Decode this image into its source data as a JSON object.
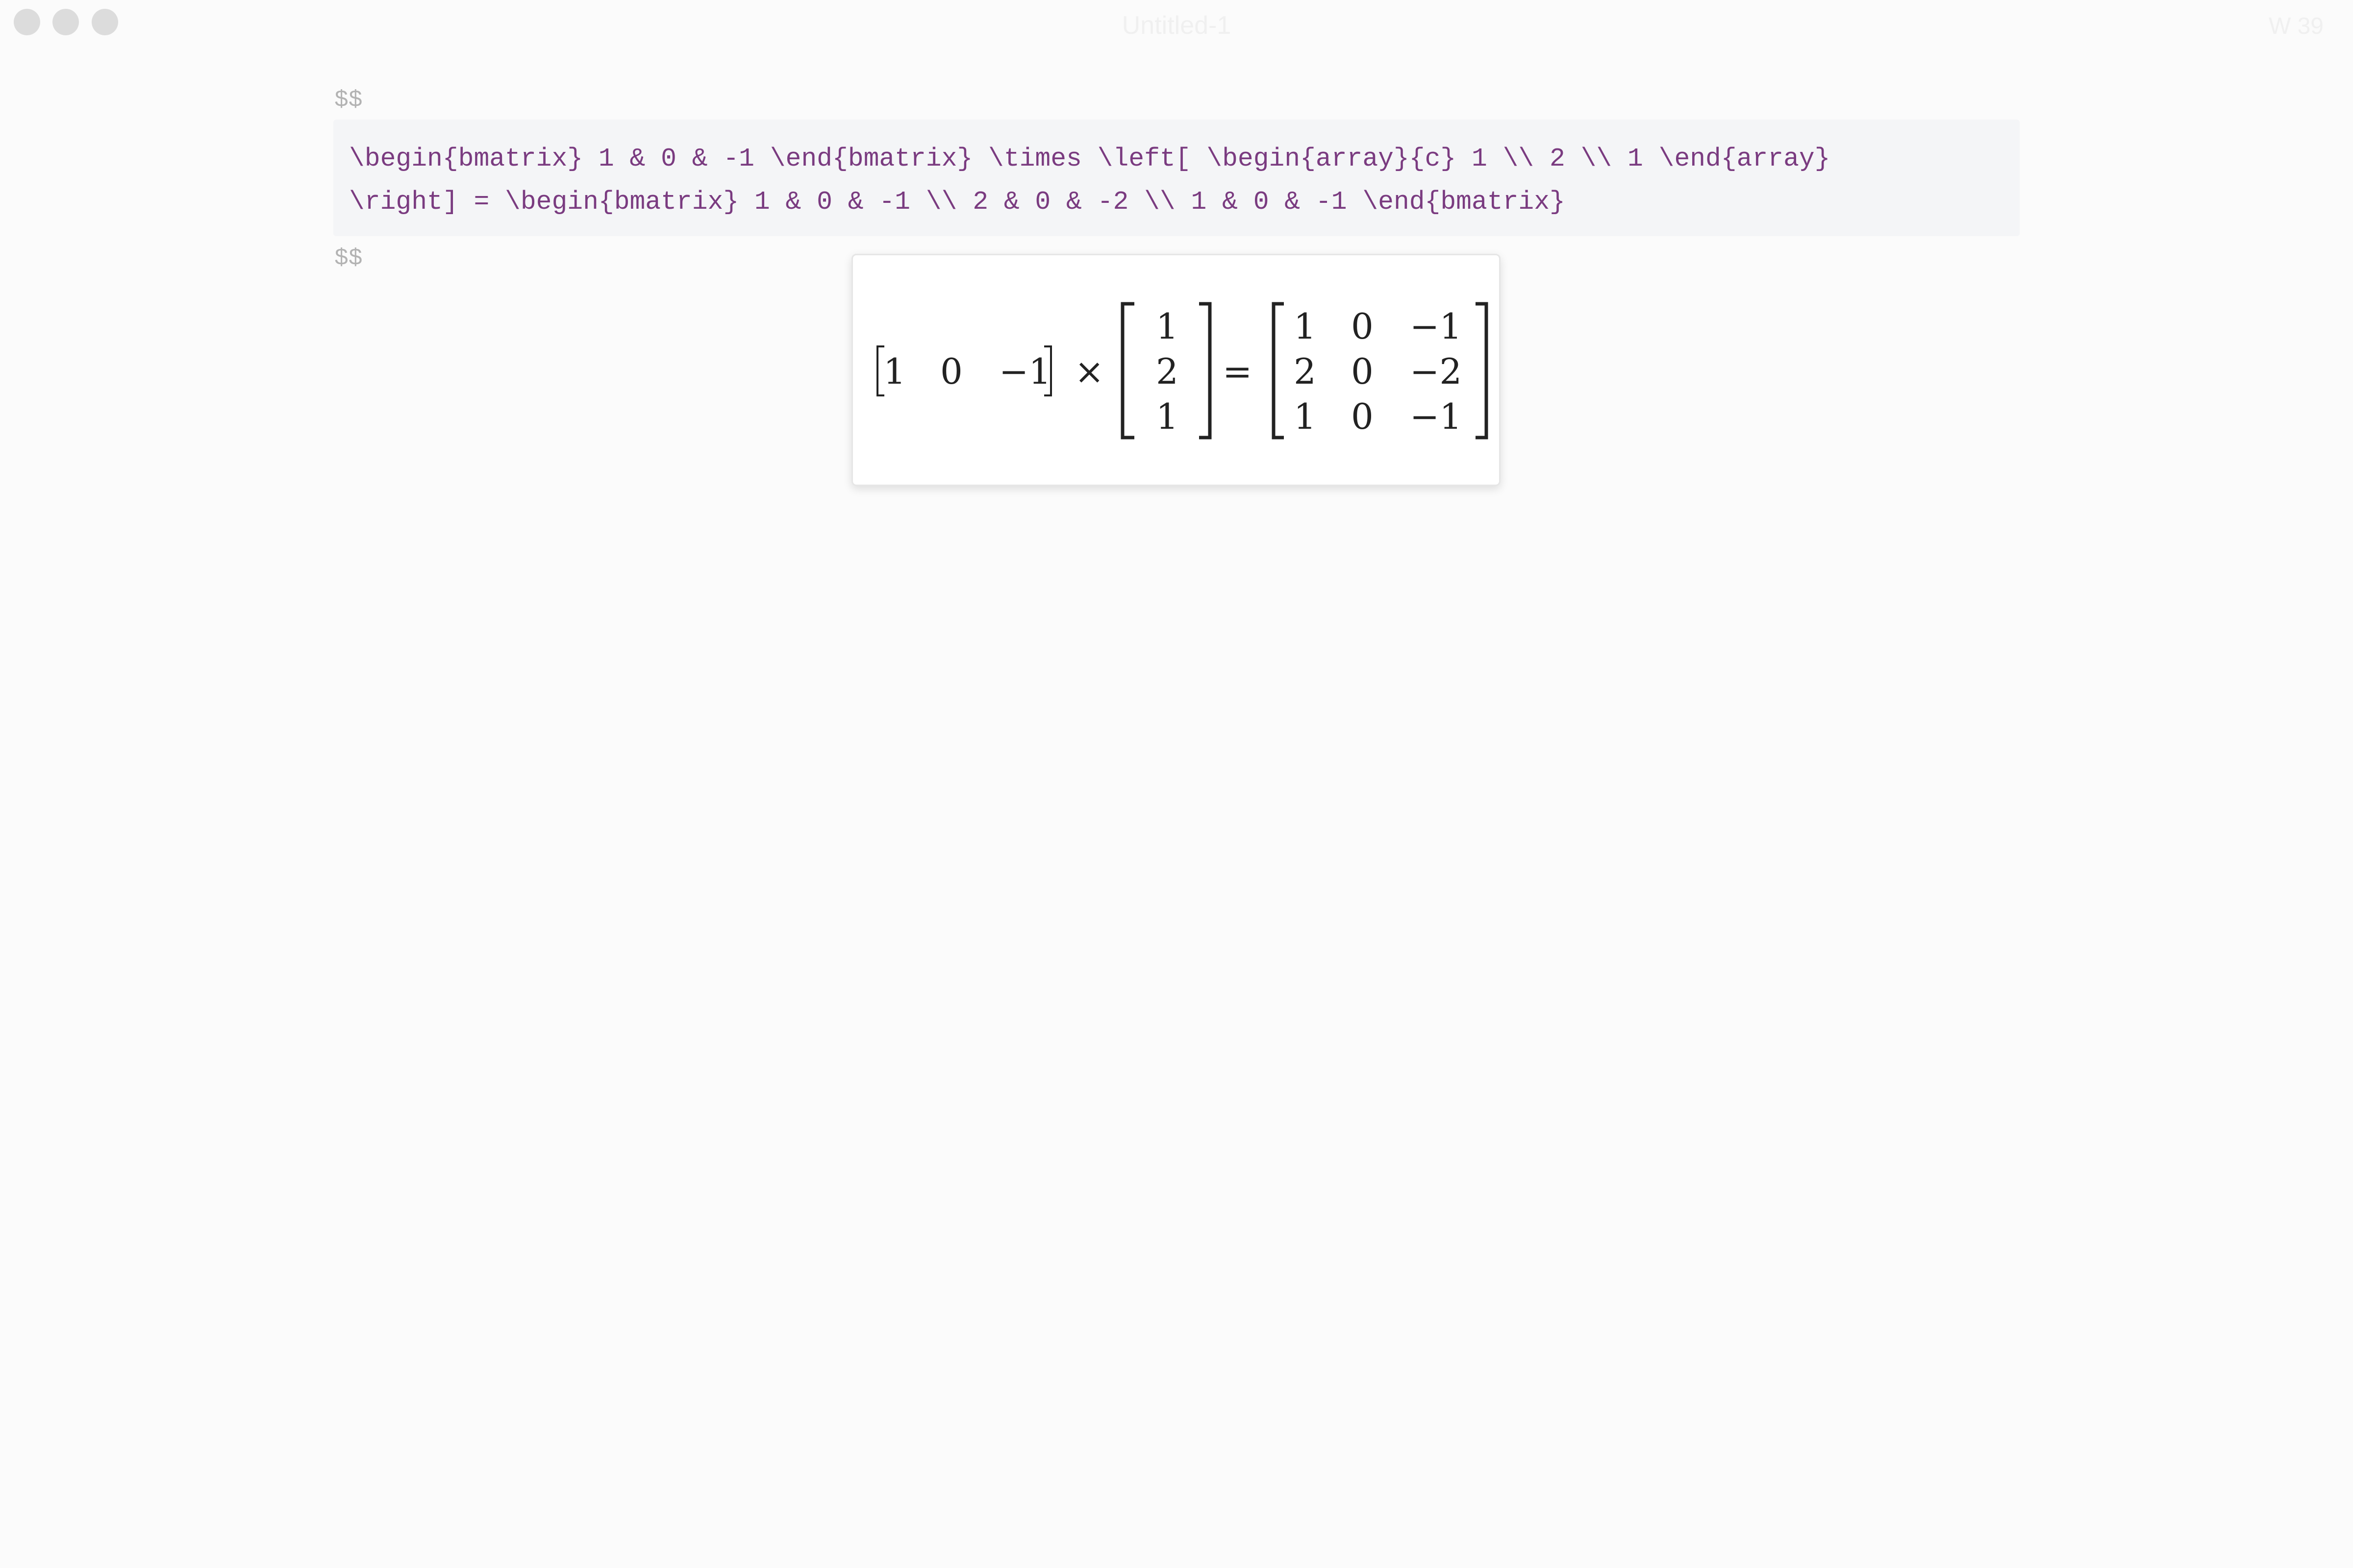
{
  "window": {
    "title": "Untitled-1",
    "word_count": "W 39"
  },
  "editor": {
    "fence_open": "$$",
    "fence_close": "$$",
    "code_lines": [
      "\\begin{bmatrix} 1 & 0 & -1 \\end{bmatrix} \\times \\left[ \\begin{array}{c} 1 \\\\ 2 \\\\ 1 \\end{array}",
      "\\right] = \\begin{bmatrix} 1 & 0 & -1 \\\\ 2 & 0 & -2 \\\\ 1 & 0 & -1 \\end{bmatrix}"
    ]
  },
  "preview": {
    "row_vector": [
      "1",
      "0",
      "−1"
    ],
    "times_symbol": "×",
    "column_vector": [
      "1",
      "2",
      "1"
    ],
    "equals_symbol": "=",
    "result_matrix": [
      [
        "1",
        "0",
        "−1"
      ],
      [
        "2",
        "0",
        "−2"
      ],
      [
        "1",
        "0",
        "−1"
      ]
    ]
  }
}
